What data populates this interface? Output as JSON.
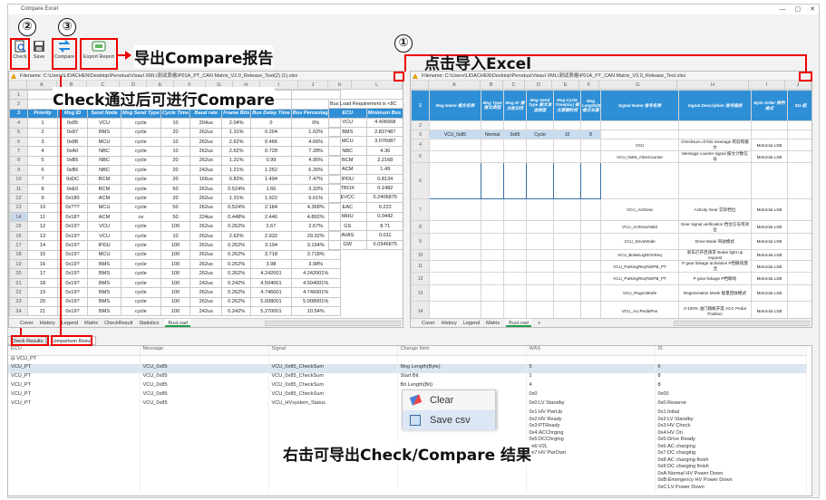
{
  "window": {
    "title": "Compare Excel",
    "controls": [
      "—",
      "▢",
      "✕"
    ]
  },
  "toolbar": {
    "check": "Check",
    "save": "Save",
    "compare": "Compare",
    "export": "Export Report"
  },
  "annotations": {
    "export_tip": "导出Compare报告",
    "import_tip": "点击导入Excel",
    "check_tip": "Check通过后可进行Compare",
    "right_click_tip": "右击可导出Check/Compare 结果",
    "n1": "①",
    "n2": "②",
    "n3": "③"
  },
  "left": {
    "filename": "Filename: C:\\Users\\LIDACHEN\\Desktop\\Perodua\\Visaul XML\\测试表格\\P01A_PT_CAN Matrix_V2.0_Release_Test(2) (1).xlsx",
    "cols": [
      "A",
      "B",
      "C",
      "D",
      "E",
      "F",
      "G",
      "H",
      "I",
      "J",
      "K",
      "L"
    ],
    "headers": [
      "Priority",
      "Msg ID",
      "Send Node",
      "Msg Send Type",
      "Cycle Time",
      "Baud rate",
      "Frame Bits",
      "Bus Delay Time",
      "Bus Percentage(%)"
    ],
    "rows": [
      [
        "1",
        "0x85",
        "VCU",
        "cycle",
        "10",
        "204us",
        "2.04%",
        "0",
        "0%"
      ],
      [
        "2",
        "0x87",
        "BMS",
        "cycle",
        "20",
        "262us",
        "1.31%",
        "0.204",
        "1.02%"
      ],
      [
        "3",
        "0x88",
        "MCU",
        "cycle",
        "10",
        "262us",
        "2.62%",
        "0.466",
        "4.66%"
      ],
      [
        "4",
        "0xA0",
        "NBC",
        "cycle",
        "10",
        "262us",
        "2.62%",
        "0.728",
        "7.28%"
      ],
      [
        "5",
        "0xB5",
        "NBC",
        "cycle",
        "20",
        "262us",
        "1.31%",
        "0.99",
        "4.95%"
      ],
      [
        "6",
        "0xB6",
        "NBC",
        "cycle",
        "20",
        "242us",
        "1.21%",
        "1.252",
        "6.26%"
      ],
      [
        "7",
        "0xDC",
        "BCM",
        "cycle",
        "20",
        "166us",
        "0.83%",
        "1.494",
        "7.47%"
      ],
      [
        "8",
        "0xE0",
        "BCM",
        "cycle",
        "50",
        "262us",
        "0.524%",
        "1.66",
        "3.32%"
      ],
      [
        "9",
        "0x180",
        "ACM",
        "cycle",
        "20",
        "262us",
        "1.31%",
        "1.922",
        "9.61%"
      ],
      [
        "10",
        "0x???",
        "MCU",
        "cycle",
        "50",
        "262us",
        "0.524%",
        "2.184",
        "4.368%"
      ],
      [
        "11",
        "0x18?",
        "ACM",
        "ce",
        "50",
        "224us",
        "0.448%",
        "2.446",
        "4.892%"
      ],
      [
        "12",
        "0x19?",
        "VCU",
        "cycle",
        "100",
        "262us",
        "0.262%",
        "2.67",
        "2.67%"
      ],
      [
        "13",
        "0x19?",
        "VCU",
        "cycle",
        "10",
        "262us",
        "2.62%",
        "2.932",
        "29.32%"
      ],
      [
        "14",
        "0x19?",
        "IPDU",
        "cycle",
        "100",
        "262us",
        "0.262%",
        "3.194",
        "3.194%"
      ],
      [
        "15",
        "0x19?",
        "MCU",
        "cycle",
        "100",
        "262us",
        "0.262%",
        "3.718",
        "3.718%"
      ],
      [
        "16",
        "0x19?",
        "BMS",
        "cycle",
        "100",
        "262us",
        "0.262%",
        "3.98",
        "3.98%"
      ],
      [
        "17",
        "0x19?",
        "BMS",
        "cycle",
        "100",
        "262us",
        "0.262%",
        "4.242001",
        "4.242001%"
      ],
      [
        "18",
        "0x19?",
        "BMS",
        "cycle",
        "100",
        "242us",
        "0.242%",
        "4.504001",
        "4.504001%"
      ],
      [
        "19",
        "0x19?",
        "BMS",
        "cycle",
        "100",
        "262us",
        "0.262%",
        "4.746001",
        "4.746001%"
      ],
      [
        "20",
        "0x19?",
        "BMS",
        "cycle",
        "100",
        "262us",
        "0.262%",
        "5.008001",
        "5.008001%"
      ],
      [
        "21",
        "0x19?",
        "BMS",
        "cycle",
        "100",
        "242us",
        "0.242%",
        "5.270001",
        "10.54%"
      ]
    ],
    "rownums": [
      "1",
      "2",
      "3",
      "4",
      "5",
      "6",
      "7",
      "8",
      "9",
      "10",
      "11",
      "12",
      "13",
      "14",
      "15",
      "16",
      "17",
      "18",
      "19",
      "20",
      "21",
      "22",
      "23"
    ],
    "bus": {
      "title": "Bus Load Requirement is <8C",
      "h1": "ECU",
      "h2": "Minimum Bus Load",
      "rows": [
        [
          "VCU",
          "4.406668"
        ],
        [
          "BMS",
          "2.837487"
        ],
        [
          "MCU",
          "3.076087"
        ],
        [
          "NBC",
          "4.36"
        ],
        [
          "BCM",
          "2.2168"
        ],
        [
          "ACM",
          "1.49"
        ],
        [
          "IPDU",
          "0.8134"
        ],
        [
          "TBOX",
          "0.1482"
        ],
        [
          "EVCC",
          "0.2406875"
        ],
        [
          "EAC",
          "0.222"
        ],
        [
          "MHU",
          "0.0442"
        ],
        [
          "GS",
          "8.71"
        ],
        [
          "AVAS",
          "0.011"
        ],
        [
          "GW",
          "0.0346875"
        ]
      ]
    },
    "tabs": [
      "Cover",
      "History",
      "Legend",
      "Matrix",
      "CheckResult",
      "Statistics",
      "BusLoad"
    ],
    "active_tab": "BusLoad"
  },
  "right": {
    "filename": "Filename: C:\\Users\\LIDACHEN\\Desktop\\Perodua\\Visaul XML\\测试表格\\P01A_PT_CAN Matrix_V3.0_Release_Test.xlsx",
    "cols": [
      "A",
      "B",
      "C",
      "D",
      "E",
      "F",
      "G",
      "H",
      "I",
      "J"
    ],
    "headers": [
      "Msg Name 报文名称",
      "Msg Type 报文类型",
      "Msg ID 报文标识符",
      "Msg Send Type 报文发送类型",
      "Msg Cycle Time(ms) 报文周期时间",
      "Msg Length(Byte) 报文长度",
      "Signal Name 信号名称",
      "Signal Description 信号描述",
      "Byte Order 排列格式",
      "Sta 起"
    ],
    "first_row": [
      "VCU_0x85",
      "Normal",
      "0x85",
      "Cycle",
      "10",
      "8"
    ],
    "signals": [
      [
        "VCU",
        "Checksum of this message 校验和报文",
        "Motorola LSB"
      ],
      [
        "VCU_0x85_AliveCounter",
        "Message counter signal 报文计数信号",
        "Motorola LSB"
      ],
      [
        "",
        "",
        " "
      ],
      [
        "VCU_ActGear",
        "Activity Gear 实际档位",
        "Motorola LSB"
      ],
      [
        "VCU_ActGearVaild",
        "Gear signal verification 档位信号有效位",
        "Motorola LSB"
      ],
      [
        "VCU_DriveMode",
        "Drive Mode 驾驶模式",
        "Motorola LSB"
      ],
      [
        "VCU_BrakeLightOnReq",
        "刹车灯开启请求 Brake light up request",
        "Motorola LSB"
      ],
      [
        "VCU_ParkingReqToEPB_PT",
        "P gear linkage activation P档联动激活",
        "Motorola LSB"
      ],
      [
        "VCU_ParkingReqToEPB_PT",
        "P gear linkage P档联动",
        "Motorola LSB"
      ],
      [
        "VCU_RegenMode",
        "Regeneration Mode 能量回收模式",
        "Motorola LSB"
      ],
      [
        "VCU_AccPedalPos",
        "0-100% 油门踏板开度 ACC Pedal Position",
        "Motorola LSB"
      ],
      [
        "VCU_VehicleSpeed",
        "Vehicle speed calculated by VCU VCU计算出的整车车速",
        "Motorola LSB"
      ],
      [
        "VCU_VehicleSpeedValid",
        "VCU output vehicle speed Valid VCU输出的整车车速信号有效",
        "Motorola LSB"
      ]
    ],
    "tabs": [
      "Cover",
      "History",
      "Legend",
      "Matrix",
      "BusLoad"
    ],
    "active_tab": "BusLoad"
  },
  "bottom_tabs": {
    "check": "Check Results",
    "compare": "Comparison Result"
  },
  "results": {
    "headers": [
      "ECU",
      "Message",
      "Signal",
      "Change Item",
      "WAS",
      "IS"
    ],
    "rows": [
      [
        "VCU_PT",
        "",
        "",
        "",
        "",
        ""
      ],
      [
        "VCU_PT",
        "VCU_0x85",
        "VCU_0x85_CheckSum",
        "Msg Length(Byte)",
        "5",
        "6"
      ],
      [
        "VCU_PT",
        "VCU_0x85",
        "VCU_0x85_CheckSum",
        "Start Bit",
        "1",
        "8"
      ],
      [
        "VCU_PT",
        "VCU_0x85",
        "VCU_0x85_CheckSum",
        "Bit Length(Bit)",
        "4",
        "8"
      ],
      [
        "VCU_PT",
        "VCU_0x85",
        "VCU_0x85_CheckSum",
        "",
        "0x0",
        "0x00"
      ],
      [
        "VCU_PT",
        "VCU_0x85",
        "VCU_HVsystem_Status",
        "",
        "0x0:LV Standby",
        "0x0:Reserve"
      ]
    ],
    "was_extra": [
      "0x1:HV PwrUp",
      "0x2:HV Ready",
      "0x3:PTReady",
      "0x4:ACChrging",
      "0x5:DCChrging",
      "0x6:V2L",
      "0x7:HV PwrDwn"
    ],
    "is_extra": [
      "0x1:Initial",
      "0x2:LV Standby",
      "0x3:HV Check",
      "0x4:HV On",
      "0x5:Drive Ready",
      "0x6:AC charging",
      "0x7:DC charging",
      "0x8:AC charging finish",
      "0x9:DC charging finish",
      "0xA:Normal HV Power Down",
      "0xB:Emergency HV Power Down",
      "0xC:LV Power Down"
    ]
  },
  "context_menu": {
    "clear": "Clear",
    "save_csv": "Save csv"
  },
  "colors": {
    "header_blue": "#2e8fd6",
    "red": "#e00000",
    "green_tab": "#1a9e4a"
  }
}
